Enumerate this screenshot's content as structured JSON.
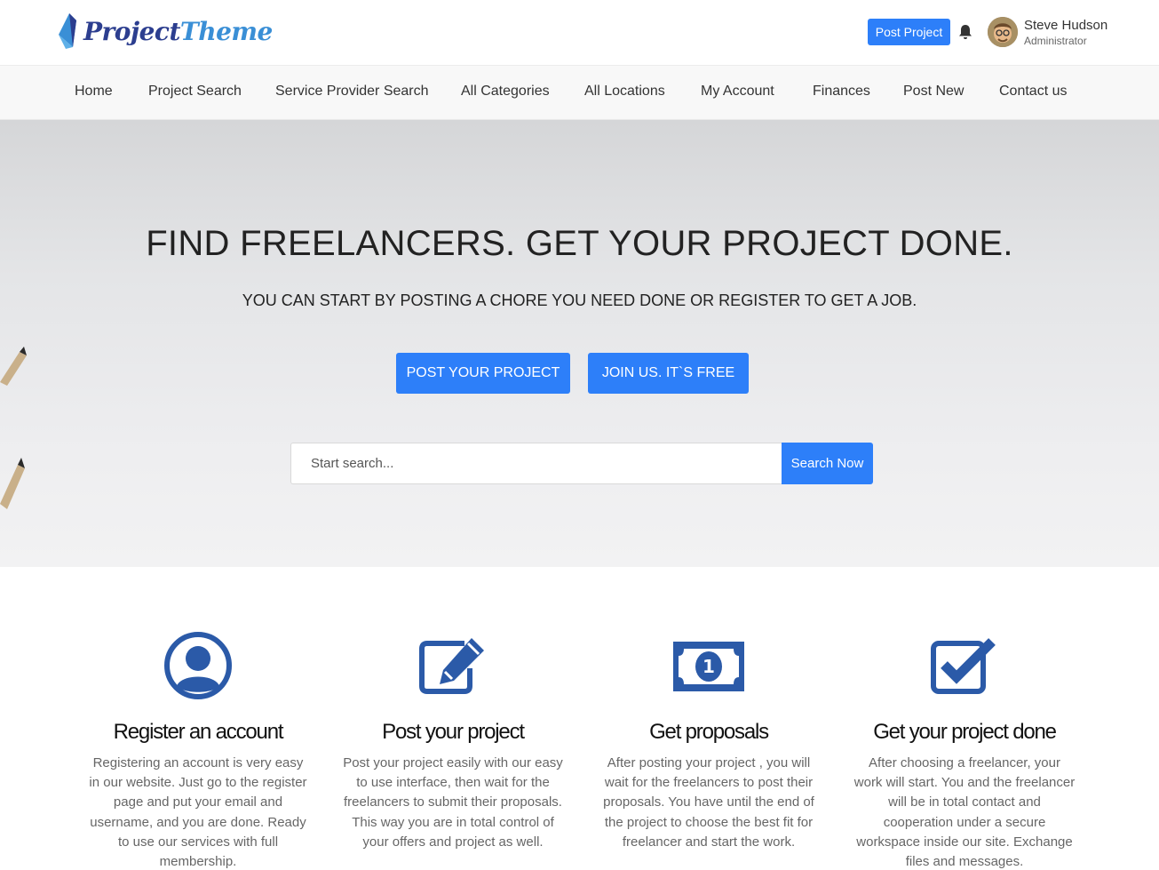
{
  "header": {
    "logo": {
      "part1": "Project",
      "part2": "Theme"
    },
    "post_project_label": "Post Project",
    "user": {
      "name": "Steve Hudson",
      "role": "Administrator"
    }
  },
  "nav": {
    "items": [
      {
        "label": "Home"
      },
      {
        "label": "Project Search"
      },
      {
        "label": "Service Provider Search"
      },
      {
        "label": "All Categories"
      },
      {
        "label": "All Locations"
      },
      {
        "label": "My Account"
      },
      {
        "label": "Finances"
      },
      {
        "label": "Post New"
      },
      {
        "label": "Contact us"
      }
    ]
  },
  "hero": {
    "title": "FIND FREELANCERS. GET YOUR PROJECT DONE.",
    "subtitle": "YOU CAN START BY POSTING A CHORE YOU NEED DONE OR REGISTER TO GET A JOB.",
    "post_button": "POST YOUR PROJECT",
    "join_button": "JOIN US. IT`S FREE",
    "search": {
      "placeholder": "Start search...",
      "button": "Search Now"
    }
  },
  "steps": [
    {
      "icon": "user-circle-icon",
      "title": "Register an account",
      "description": "Registering an account is very easy in our website. Just go to the register page and put your email and username, and you are done. Ready to use our services with full membership."
    },
    {
      "icon": "edit-icon",
      "title": "Post your project",
      "description": "Post your project easily with our easy to use interface, then wait for the freelancers to submit their proposals. This way you are in total control of your offers and project as well."
    },
    {
      "icon": "money-bill-icon",
      "title": "Get proposals",
      "description": "After posting your project , you will wait for the freelancers to post their proposals. You have until the end of the project to choose the best fit for freelancer and start the work."
    },
    {
      "icon": "check-square-icon",
      "title": "Get your project done",
      "description": "After choosing a freelancer, your work will start. You and the freelancer will be in total contact and cooperation under a secure workspace inside our site. Exchange files and messages."
    }
  ],
  "colors": {
    "primary": "#2d7ff9",
    "icon": "#2b5aa8",
    "logo_dark": "#2c3e8f",
    "logo_light": "#3a8fd6"
  }
}
